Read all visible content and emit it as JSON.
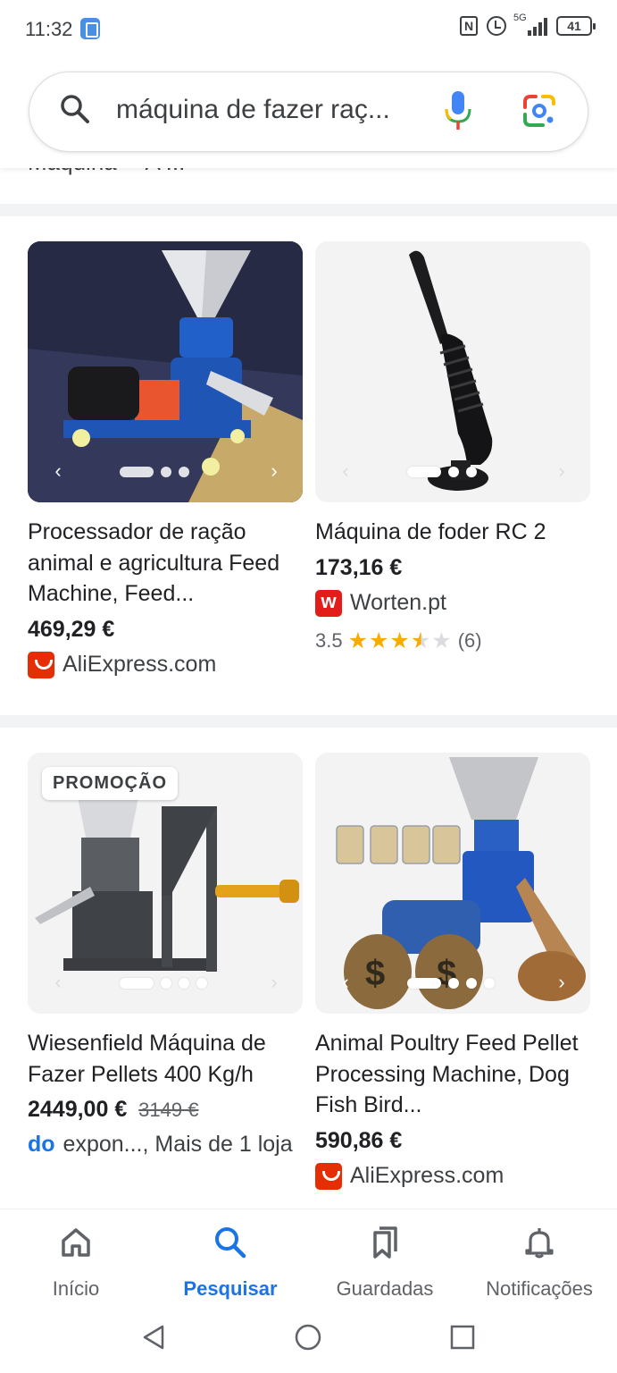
{
  "status_bar": {
    "time": "11:32",
    "network": "5G",
    "battery": "41",
    "icons": [
      "app-notification-icon",
      "nfc-icon",
      "alarm-icon",
      "signal-icon",
      "battery-icon"
    ]
  },
  "search": {
    "query": "máquina de fazer raç...",
    "icons": [
      "search-icon",
      "mic-icon",
      "google-lens-icon"
    ]
  },
  "partial_result": {
    "text": "Máquina··· A ..."
  },
  "products": [
    {
      "title": "Processador de ração animal e agricultura Feed Machine, Feed...",
      "price": "469,29 €",
      "seller": "AliExpress.com",
      "seller_logo": "aliexpress-logo-icon",
      "carousel_dots": 3
    },
    {
      "title": "Máquina de foder RC 2",
      "price": "173,16 €",
      "seller": "Worten.pt",
      "seller_logo": "worten-logo-icon",
      "rating": "3.5",
      "rating_value": 3.5,
      "reviews": "(6)",
      "carousel_dots": 3
    },
    {
      "badge": "PROMOÇÃO",
      "title": "Wiesenfield Máquina de Fazer Pellets 400 Kg/h",
      "price": "2449,00 €",
      "old_price": "3149 €",
      "seller_prefix": "do",
      "seller": "expon..., Mais de 1 loja",
      "carousel_dots": 4
    },
    {
      "title": "Animal Poultry Feed Pellet Processing Machine, Dog Fish Bird...",
      "price": "590,86 €",
      "seller": "AliExpress.com",
      "seller_logo": "aliexpress-logo-icon",
      "carousel_dots": 4
    }
  ],
  "bottom_nav": {
    "home": "Início",
    "search": "Pesquisar",
    "saved": "Guardadas",
    "notifications": "Notificações"
  },
  "colors": {
    "accent": "#1a73e8",
    "star": "#f9ab00",
    "aliexpress": "#e62e04",
    "worten": "#e31d1a",
    "divider": "#f1f3f4"
  }
}
